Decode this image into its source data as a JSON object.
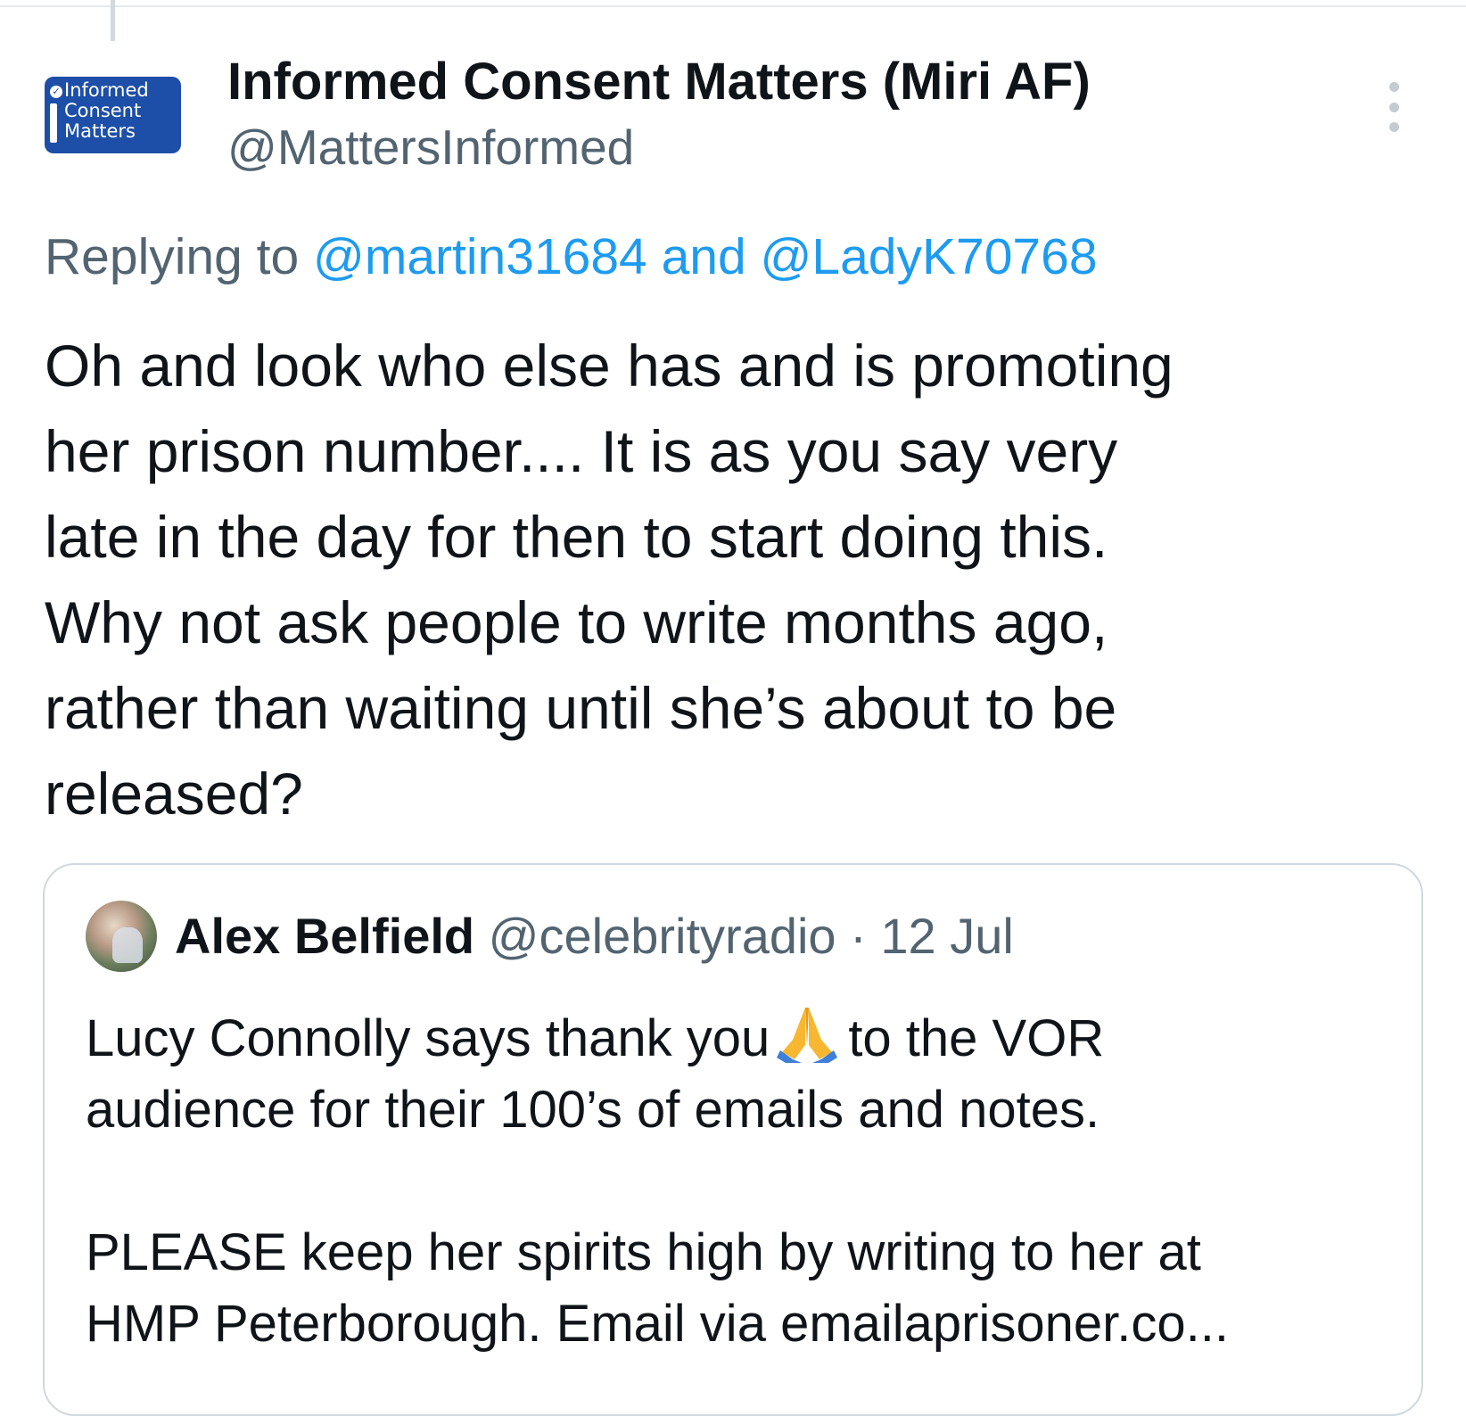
{
  "tweet": {
    "author": {
      "display_name": "Informed Consent Matters (Miri AF)",
      "handle": "@MattersInformed",
      "avatar_logo_lines": [
        "Informed",
        "Consent",
        "Matters"
      ]
    },
    "more_menu_icon": "more-vertical-icon",
    "replying": {
      "prefix": "Replying to ",
      "user1": "@martin31684",
      "conjunction": " and ",
      "user2": "@LadyK70768"
    },
    "body_lines": [
      "Oh and look who else has and is promoting",
      "her prison number....  It is as you say very",
      "late in the day for then to start doing this.",
      "Why not ask people to write months ago,",
      "rather than waiting until she’s about to be",
      "released?"
    ]
  },
  "quoted_tweet": {
    "author_name": "Alex Belfield",
    "handle": "@celebrityradio",
    "separator": " · ",
    "date": "12 Jul",
    "line1_before_emoji": "Lucy Connolly says thank you",
    "emoji": "folded-hands-icon",
    "line1_after_emoji": "to the VOR",
    "line2": "audience for their 100’s of emails and notes.",
    "line3": "",
    "line4": "PLEASE keep her spirits high by writing to her at",
    "line5": "HMP Peterborough. Email via emailaprisoner.co..."
  },
  "colors": {
    "text_primary": "#0f1419",
    "text_secondary": "#536471",
    "link": "#1d9bf0",
    "border": "#cfd9de",
    "logo_blue": "#1d4fa8"
  }
}
